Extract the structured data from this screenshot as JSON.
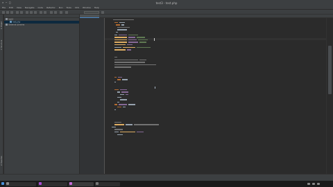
{
  "window": {
    "title": "test3 - test.php"
  },
  "menu": [
    "File",
    "Edit",
    "View",
    "Navigate",
    "Code",
    "Refactor",
    "Run",
    "Tools",
    "VCS",
    "Window",
    "Help"
  ],
  "project": {
    "rows": [
      {
        "label": "test3"
      },
      {
        "label": "test.php"
      },
      {
        "label": "External Libraries"
      }
    ]
  },
  "tool_windows": {
    "project": "1: Project",
    "structure": "7: Structure",
    "favorites": "2: Favorites"
  },
  "colors": {
    "keyword": "#cc7832",
    "string": "#6a8759",
    "variable": "#9876aa",
    "comment": "#808080",
    "function": "#ffc66d",
    "text": "#a9b7c6"
  },
  "taskbar": {
    "icons": [
      "start-icon",
      "terminal-icon",
      "browser-icon",
      "ide-icon",
      "files-icon"
    ],
    "clock_time": "",
    "clock_date": ""
  }
}
